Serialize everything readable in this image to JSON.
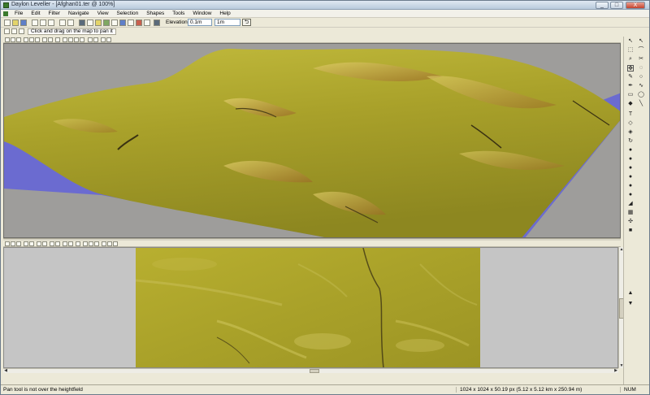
{
  "window": {
    "title": "Daylon Leveller - [Afghan01.ter @ 100%]",
    "buttons": {
      "minimize": "_",
      "maximize": "□",
      "close": "X"
    }
  },
  "menubar": {
    "items": [
      "File",
      "Edit",
      "Filter",
      "Navigate",
      "View",
      "Selection",
      "Shapes",
      "Tools",
      "Window",
      "Help"
    ]
  },
  "toolbar": {
    "elevations_label": "Elevations:",
    "elevation_value": "0.1m",
    "elevation_step": "1m"
  },
  "hint": {
    "text": "Click and drag on the map to pan it"
  },
  "views": {
    "perspective": {
      "terrain_color": "#a8a22a",
      "water_color": "#6b6bd0",
      "background": "#9e9d9b"
    },
    "plan": {
      "background": "#c5c5c5",
      "map_color": "#b5ad2c"
    }
  },
  "status": {
    "message": "Pan tool is not over the heightfield",
    "dimensions": "1024 x 1024 x 50.19 px (5.12 x 5.12 km x 250.94 m)",
    "numlock": "NUM"
  },
  "icons": {
    "right_toolbar": [
      "arrow-icon",
      "arrow-icon",
      "select-icon",
      "zoom-icon",
      "pan-icon",
      "lasso-icon",
      "brush-icon",
      "ellipse-icon",
      "pen-icon",
      "curve-icon",
      "rect-icon",
      "circle-icon",
      "marker-icon",
      "line-icon",
      "text-icon",
      "diamond-icon",
      "eraser-icon",
      "rotate-icon",
      "dot-icon",
      "dot-icon",
      "dot-icon",
      "dot-icon",
      "dot-icon",
      "dot-icon",
      "diagonal-icon",
      "grid-icon",
      "network-icon",
      "square-icon"
    ]
  }
}
